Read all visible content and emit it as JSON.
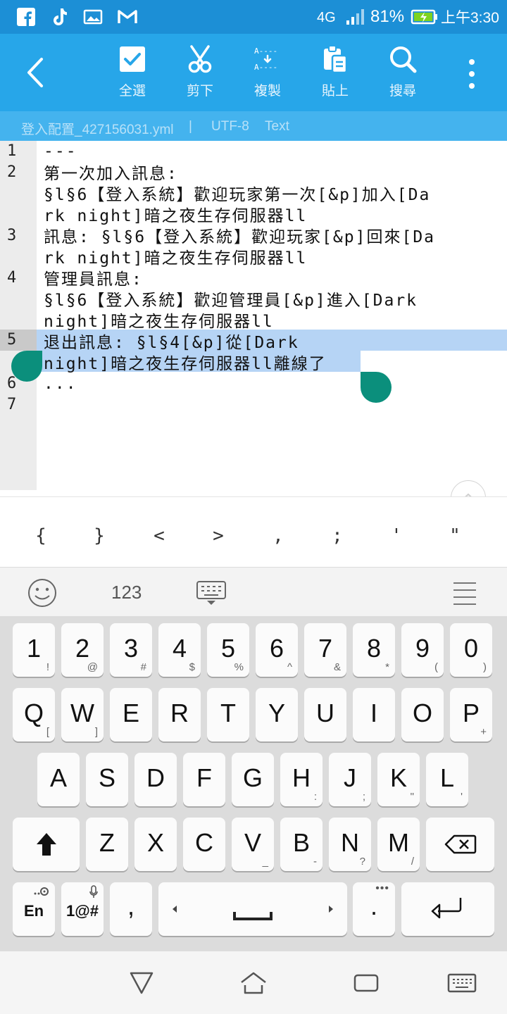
{
  "status_bar": {
    "network": "4G",
    "battery": "81%",
    "time": "上午3:30",
    "icons": [
      "facebook-icon",
      "tiktok-icon",
      "image-icon",
      "gmail-icon",
      "signal-icon",
      "battery-charging-icon"
    ]
  },
  "toolbar": {
    "back_icon": "back-arrow-icon",
    "actions": [
      {
        "label": "全選",
        "icon": "select-all-icon"
      },
      {
        "label": "剪下",
        "icon": "scissors-icon"
      },
      {
        "label": "複製",
        "icon": "copy-icon"
      },
      {
        "label": "貼上",
        "icon": "clipboard-icon"
      },
      {
        "label": "搜尋",
        "icon": "search-icon"
      }
    ],
    "more_icon": "more-vertical-icon"
  },
  "file_info": {
    "filename": "登入配置_427156031.yml",
    "separator": "|",
    "encoding": "UTF-8",
    "mode": "Text"
  },
  "editor": {
    "line_numbers": [
      "1",
      "2",
      "3",
      "4",
      "5",
      "6",
      "7"
    ],
    "rows": [
      "---",
      "第一次加入訊息:",
      "§l§6【登入系統】歡迎玩家第一次[&p]加入[Da",
      "rk night]暗之夜生存伺服器ll",
      "訊息: §l§6【登入系統】歡迎玩家[&p]回來[Da",
      "rk night]暗之夜生存伺服器ll",
      "管理員訊息:",
      "§l§6【登入系統】歡迎管理員[&p]進入[Dark",
      "night]暗之夜生存伺服器ll",
      "退出訊息: §l§4[&p]從[Dark",
      "night]暗之夜生存伺服器ll離線了",
      "..."
    ]
  },
  "symbols": [
    "{",
    "}",
    "<",
    ">",
    ",",
    ";",
    "'",
    "\""
  ],
  "keyboard": {
    "toolbar": {
      "emoji_icon": "emoji-icon",
      "numbers_label": "123",
      "keyboard_icon": "keyboard-hide-icon",
      "menu_icon": "menu-lines-icon"
    },
    "number_row": [
      {
        "main": "1",
        "sub": "!"
      },
      {
        "main": "2",
        "sub": "@"
      },
      {
        "main": "3",
        "sub": "#"
      },
      {
        "main": "4",
        "sub": "$"
      },
      {
        "main": "5",
        "sub": "%"
      },
      {
        "main": "6",
        "sub": "^"
      },
      {
        "main": "7",
        "sub": "&"
      },
      {
        "main": "8",
        "sub": "*"
      },
      {
        "main": "9",
        "sub": "("
      },
      {
        "main": "0",
        "sub": ")"
      }
    ],
    "row1": [
      {
        "main": "Q",
        "sub": "["
      },
      {
        "main": "W",
        "sub": "]"
      },
      {
        "main": "E",
        "sub": ""
      },
      {
        "main": "R",
        "sub": ""
      },
      {
        "main": "T",
        "sub": ""
      },
      {
        "main": "Y",
        "sub": ""
      },
      {
        "main": "U",
        "sub": ""
      },
      {
        "main": "I",
        "sub": ""
      },
      {
        "main": "O",
        "sub": ""
      },
      {
        "main": "P",
        "sub": "+"
      }
    ],
    "row2": [
      {
        "main": "A",
        "sub": ""
      },
      {
        "main": "S",
        "sub": ""
      },
      {
        "main": "D",
        "sub": ""
      },
      {
        "main": "F",
        "sub": ""
      },
      {
        "main": "G",
        "sub": ""
      },
      {
        "main": "H",
        "sub": ":"
      },
      {
        "main": "J",
        "sub": ";"
      },
      {
        "main": "K",
        "sub": "\""
      },
      {
        "main": "L",
        "sub": "'"
      }
    ],
    "row3": [
      {
        "main": "Z",
        "sub": ""
      },
      {
        "main": "X",
        "sub": ""
      },
      {
        "main": "C",
        "sub": ""
      },
      {
        "main": "V",
        "sub": "_"
      },
      {
        "main": "B",
        "sub": "-"
      },
      {
        "main": "N",
        "sub": "?"
      },
      {
        "main": "M",
        "sub": "/"
      }
    ],
    "bottom": {
      "lang": "En",
      "symbols": "1@#",
      "comma": ",",
      "period": "."
    },
    "icons": {
      "shift": "shift-icon",
      "backspace": "backspace-icon",
      "space": "spacebar-icon",
      "enter": "enter-icon",
      "mic": "mic-icon",
      "settings": "settings-icon"
    }
  },
  "navbar": {
    "icons": [
      "back-triangle-icon",
      "home-icon",
      "recents-icon",
      "keyboard-switch-icon"
    ]
  }
}
